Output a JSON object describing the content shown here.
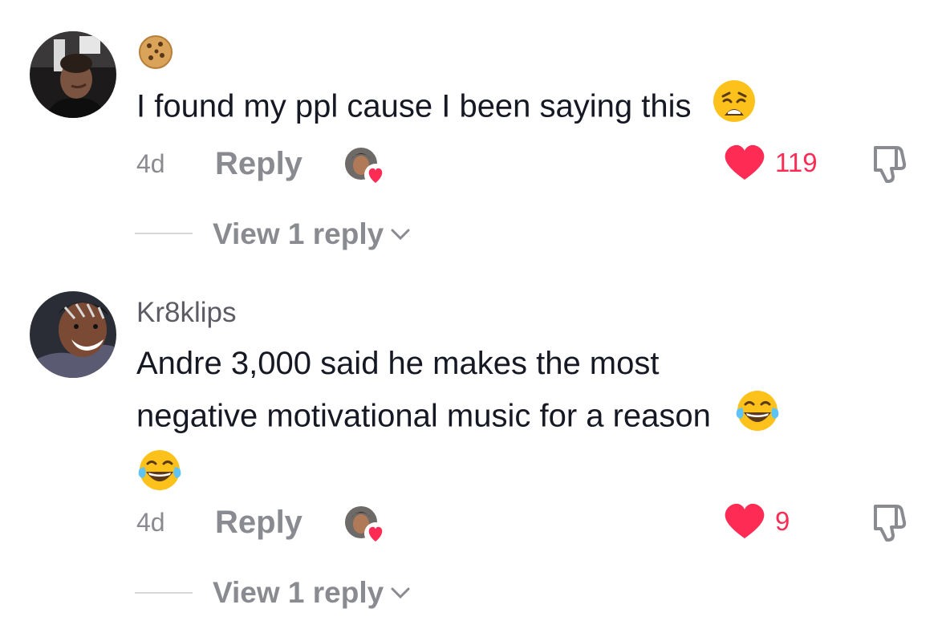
{
  "comments": [
    {
      "username": "",
      "text": "I found my ppl cause I been saying this",
      "time": "4d",
      "reply_label": "Reply",
      "likes": "119",
      "view_replies": "View 1 reply"
    },
    {
      "username": "Kr8klips",
      "text_line1": "Andre 3,000 said he makes the most",
      "text_line2": "negative motivational music for a reason",
      "time": "4d",
      "reply_label": "Reply",
      "likes": "9",
      "view_replies": "View 1 reply"
    }
  ],
  "colors": {
    "like": "#fe2c55",
    "muted": "#8a8b91",
    "text": "#161823"
  },
  "icons": [
    "cookie-icon",
    "weary-face-icon",
    "tears-of-joy-icon",
    "heart-icon",
    "dislike-icon",
    "chevron-down-icon"
  ]
}
